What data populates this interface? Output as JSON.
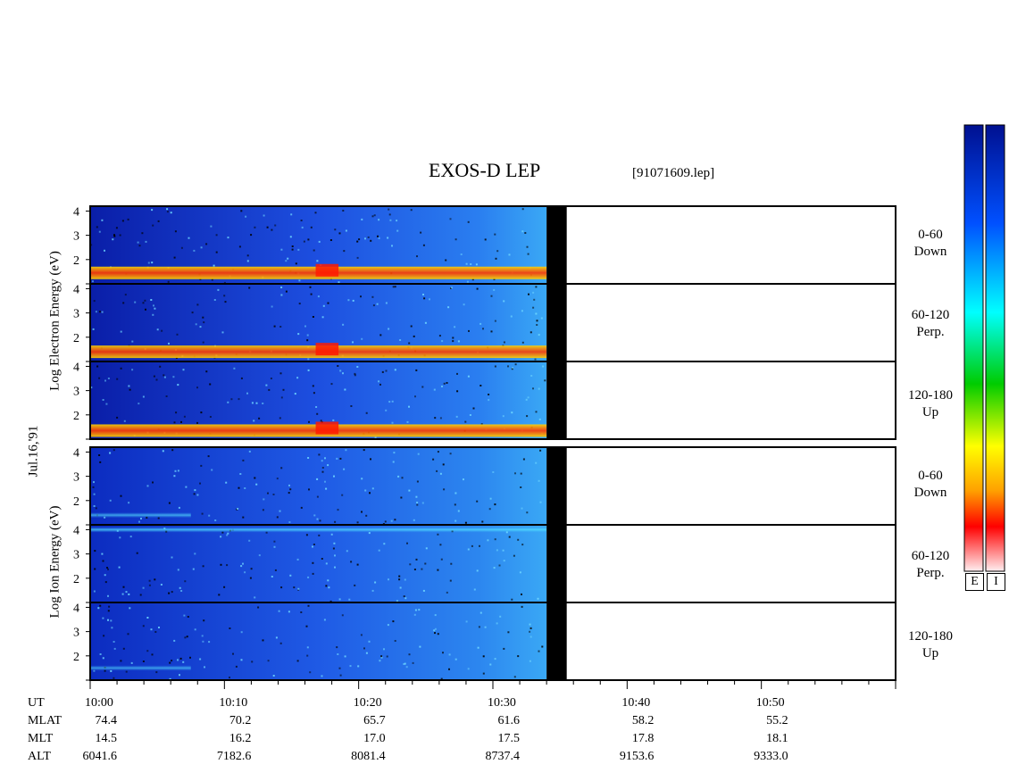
{
  "title": "EXOS-D LEP",
  "file_label": "[91071609.lep]",
  "date_label": "Jul.16,'91",
  "electron_axis_label": "Log  Electron  Energy (eV)",
  "ion_axis_label": "Log  Ion  Energy (eV)",
  "colorbar_labels": [
    "E",
    "I"
  ],
  "chart_data": {
    "type": "heatmap",
    "x_ticks": [
      "10:00",
      "10:10",
      "10:20",
      "10:30",
      "10:40",
      "10:50"
    ],
    "x_range_minutes": [
      0,
      60
    ],
    "data_end_minute": 34.0,
    "gap_minutes": [
      34.0,
      35.5
    ],
    "y_ticks": [
      "4",
      "3",
      "2"
    ],
    "y_range": [
      1,
      4.2
    ],
    "panels": [
      {
        "species": "electron",
        "pitch": "0-60",
        "direction": "Down",
        "band_log_energy": 1.45,
        "band_intensity": 0.9
      },
      {
        "species": "electron",
        "pitch": "60-120",
        "direction": "Perp.",
        "band_log_energy": 1.4,
        "band_intensity": 0.88
      },
      {
        "species": "electron",
        "pitch": "120-180",
        "direction": "Up",
        "band_log_energy": 1.35,
        "band_intensity": 0.9
      },
      {
        "species": "ion",
        "pitch": "0-60",
        "direction": "Down",
        "band_log_energy": 1.4,
        "band_intensity": 0.4
      },
      {
        "species": "ion",
        "pitch": "60-120",
        "direction": "Perp.",
        "band_log_energy": 4.0,
        "band_intensity": 0.5
      },
      {
        "species": "ion",
        "pitch": "120-180",
        "direction": "Up",
        "band_log_energy": 1.5,
        "band_intensity": 0.35
      }
    ],
    "ephemeris": {
      "rows": [
        {
          "label": "UT",
          "values": [
            "10:00",
            "10:10",
            "10:20",
            "10:30",
            "10:40",
            "10:50"
          ]
        },
        {
          "label": "MLAT",
          "values": [
            "74.4",
            "70.2",
            "65.7",
            "61.6",
            "58.2",
            "55.2"
          ]
        },
        {
          "label": "MLT",
          "values": [
            "14.5",
            "16.2",
            "17.0",
            "17.5",
            "17.8",
            "18.1"
          ]
        },
        {
          "label": "ALT",
          "values": [
            "6041.6",
            "7182.6",
            "8081.4",
            "8737.4",
            "9153.6",
            "9333.0"
          ]
        }
      ]
    },
    "colorscale": [
      "#ffeef0",
      "#ff0000",
      "#ffa000",
      "#ffff00",
      "#00cc00",
      "#00ffff",
      "#0050ff",
      "#001090"
    ]
  }
}
